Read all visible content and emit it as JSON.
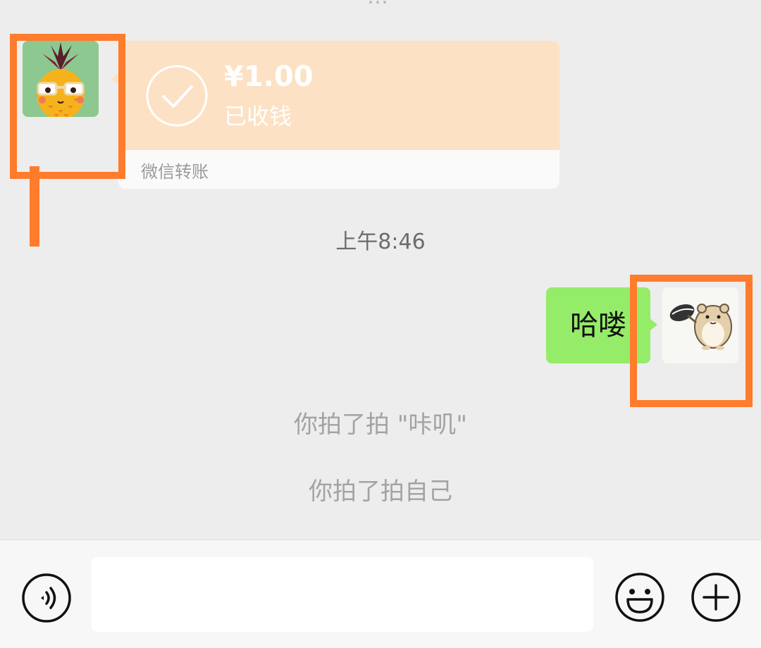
{
  "chat": {
    "cut_off_text": "…"
  },
  "transfer": {
    "amount": "¥1.00",
    "status": "已收钱",
    "footer": "微信转账"
  },
  "timestamp": "上午8:46",
  "outgoing_message": "哈喽",
  "system_messages": [
    "你拍了拍 \"咔叽\"",
    "你拍了拍自己"
  ],
  "input": {
    "value": "",
    "placeholder": ""
  },
  "icons": {
    "voice": "voice-icon",
    "emoji": "emoji-icon",
    "plus": "plus-icon",
    "check": "check-icon"
  },
  "colors": {
    "background": "#ededed",
    "transfer_card": "#fce1c4",
    "outgoing_bubble": "#95ec69",
    "highlight": "#ff7c2c"
  }
}
